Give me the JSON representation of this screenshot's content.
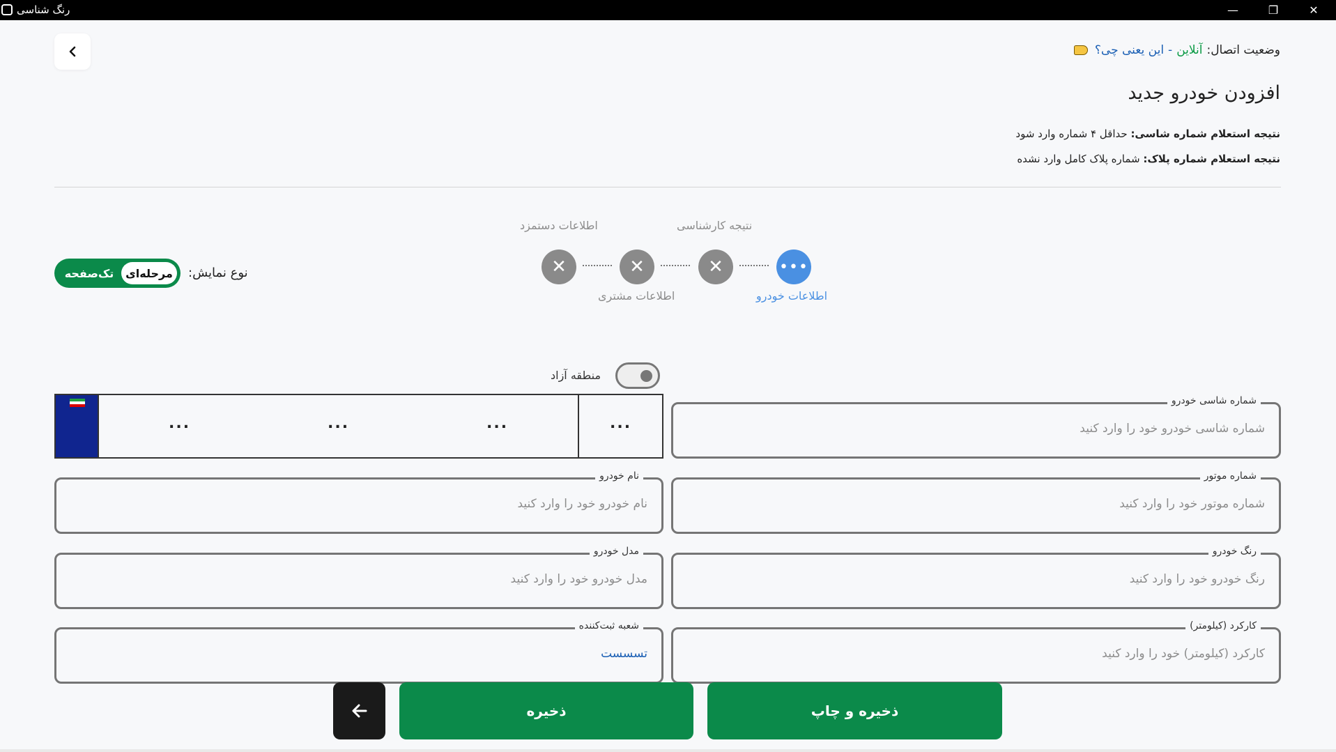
{
  "window": {
    "title": "رنگ شناسی",
    "minimize_glyph": "—",
    "restore_glyph": "❐",
    "close_glyph": "✕"
  },
  "header": {
    "connection_label": "وضعیت اتصال:",
    "connection_status": "آنلاین",
    "connection_sep": "-",
    "connection_help": "این یعنی چی؟",
    "page_title": "افزودن خودرو جدید",
    "chassis_inquiry_label": "نتیجه استعلام شماره شاسی:",
    "chassis_inquiry_value": "حداقل ۴ شماره وارد شود",
    "plate_inquiry_label": "نتیجه استعلام شماره پلاک:",
    "plate_inquiry_value": "شماره پلاک کامل وارد نشده"
  },
  "view_type": {
    "label": "نوع نمایش:",
    "options": [
      "مرحله‌ای",
      "تک‌صفحه"
    ],
    "selected": "مرحله‌ای"
  },
  "stepper": {
    "steps": [
      {
        "label": "اطلاعات خودرو",
        "state": "active",
        "glyph": "•••"
      },
      {
        "label": "نتیجه کارشناسی",
        "state": "done",
        "glyph": "✕"
      },
      {
        "label": "اطلاعات مشتری",
        "state": "done",
        "glyph": "✕"
      },
      {
        "label": "اطلاعات دستمزد",
        "state": "done",
        "glyph": "✕"
      }
    ]
  },
  "free_zone": {
    "label": "منطقه آزاد",
    "checked": false
  },
  "plate": {
    "segments": [
      "...",
      "...",
      "...",
      "..."
    ]
  },
  "form": {
    "chassis": {
      "label": "شماره شاسی خودرو",
      "placeholder": "شماره شاسی خودرو خود را وارد کنید",
      "value": ""
    },
    "engine": {
      "label": "شماره موتور",
      "placeholder": "شماره موتور خود را وارد کنید",
      "value": ""
    },
    "car_name": {
      "label": "نام خودرو",
      "placeholder": "نام خودرو خود را وارد کنید",
      "value": ""
    },
    "color": {
      "label": "رنگ خودرو",
      "placeholder": "رنگ خودرو خود را وارد کنید",
      "value": ""
    },
    "model": {
      "label": "مدل خودرو",
      "placeholder": "مدل خودرو خود را وارد کنید",
      "value": ""
    },
    "mileage": {
      "label": "کارکرد (کیلومتر)",
      "placeholder": "کارکرد (کیلومتر) خود را وارد کنید",
      "value": ""
    },
    "branch": {
      "label": "شعبه ثبت‌کننده",
      "placeholder": "",
      "value": "تسسست"
    }
  },
  "actions": {
    "save_print": "ذخیره و چاپ",
    "save": "ذخیره",
    "next_icon": "arrow-left-icon"
  },
  "colors": {
    "accent_green": "#0b8a4a",
    "step_active": "#4a90e2",
    "step_done": "#8a8a8a",
    "online": "#0a9a44",
    "plate_blue": "#10258f"
  }
}
